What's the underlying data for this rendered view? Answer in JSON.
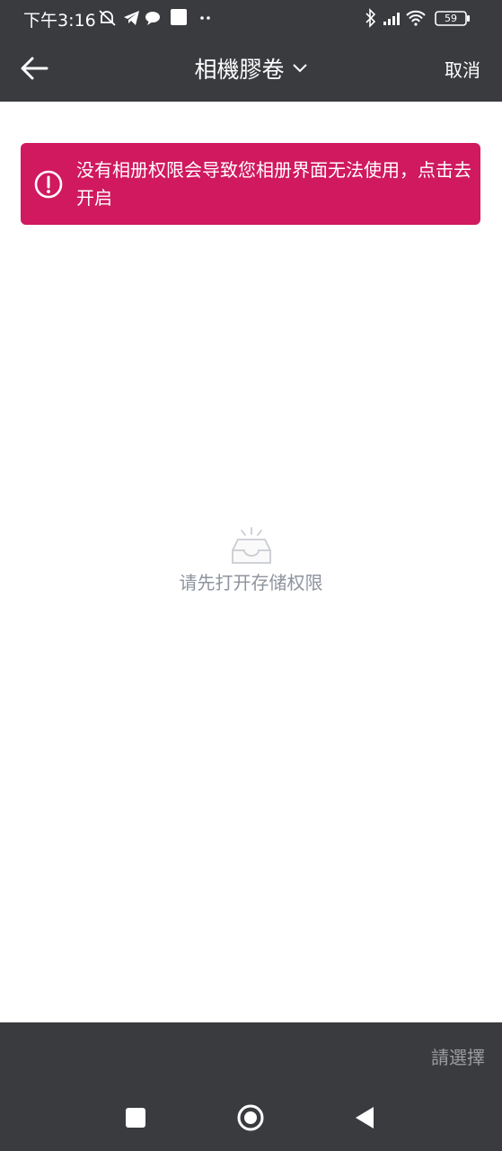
{
  "status_bar": {
    "time": "下午3:16",
    "battery": "59"
  },
  "header": {
    "title": "相機膠卷",
    "cancel_label": "取消"
  },
  "permission_banner": {
    "text": "没有相册权限会导致您相册界面无法使用，点击去开启",
    "color": "#d0195f"
  },
  "empty_state": {
    "text": "请先打开存储权限"
  },
  "bottom_bar": {
    "select_label": "請選擇"
  },
  "icons": {
    "back": "arrow-left-icon",
    "title_dropdown": "chevron-down-icon",
    "alert": "alert-circle-icon",
    "empty": "inbox-icon",
    "nav_recents": "square-icon",
    "nav_home": "circle-icon",
    "nav_back": "triangle-back-icon"
  },
  "colors": {
    "bar_background": "#3a3b3f",
    "page_background": "#ffffff",
    "empty_text": "#8e949e"
  }
}
